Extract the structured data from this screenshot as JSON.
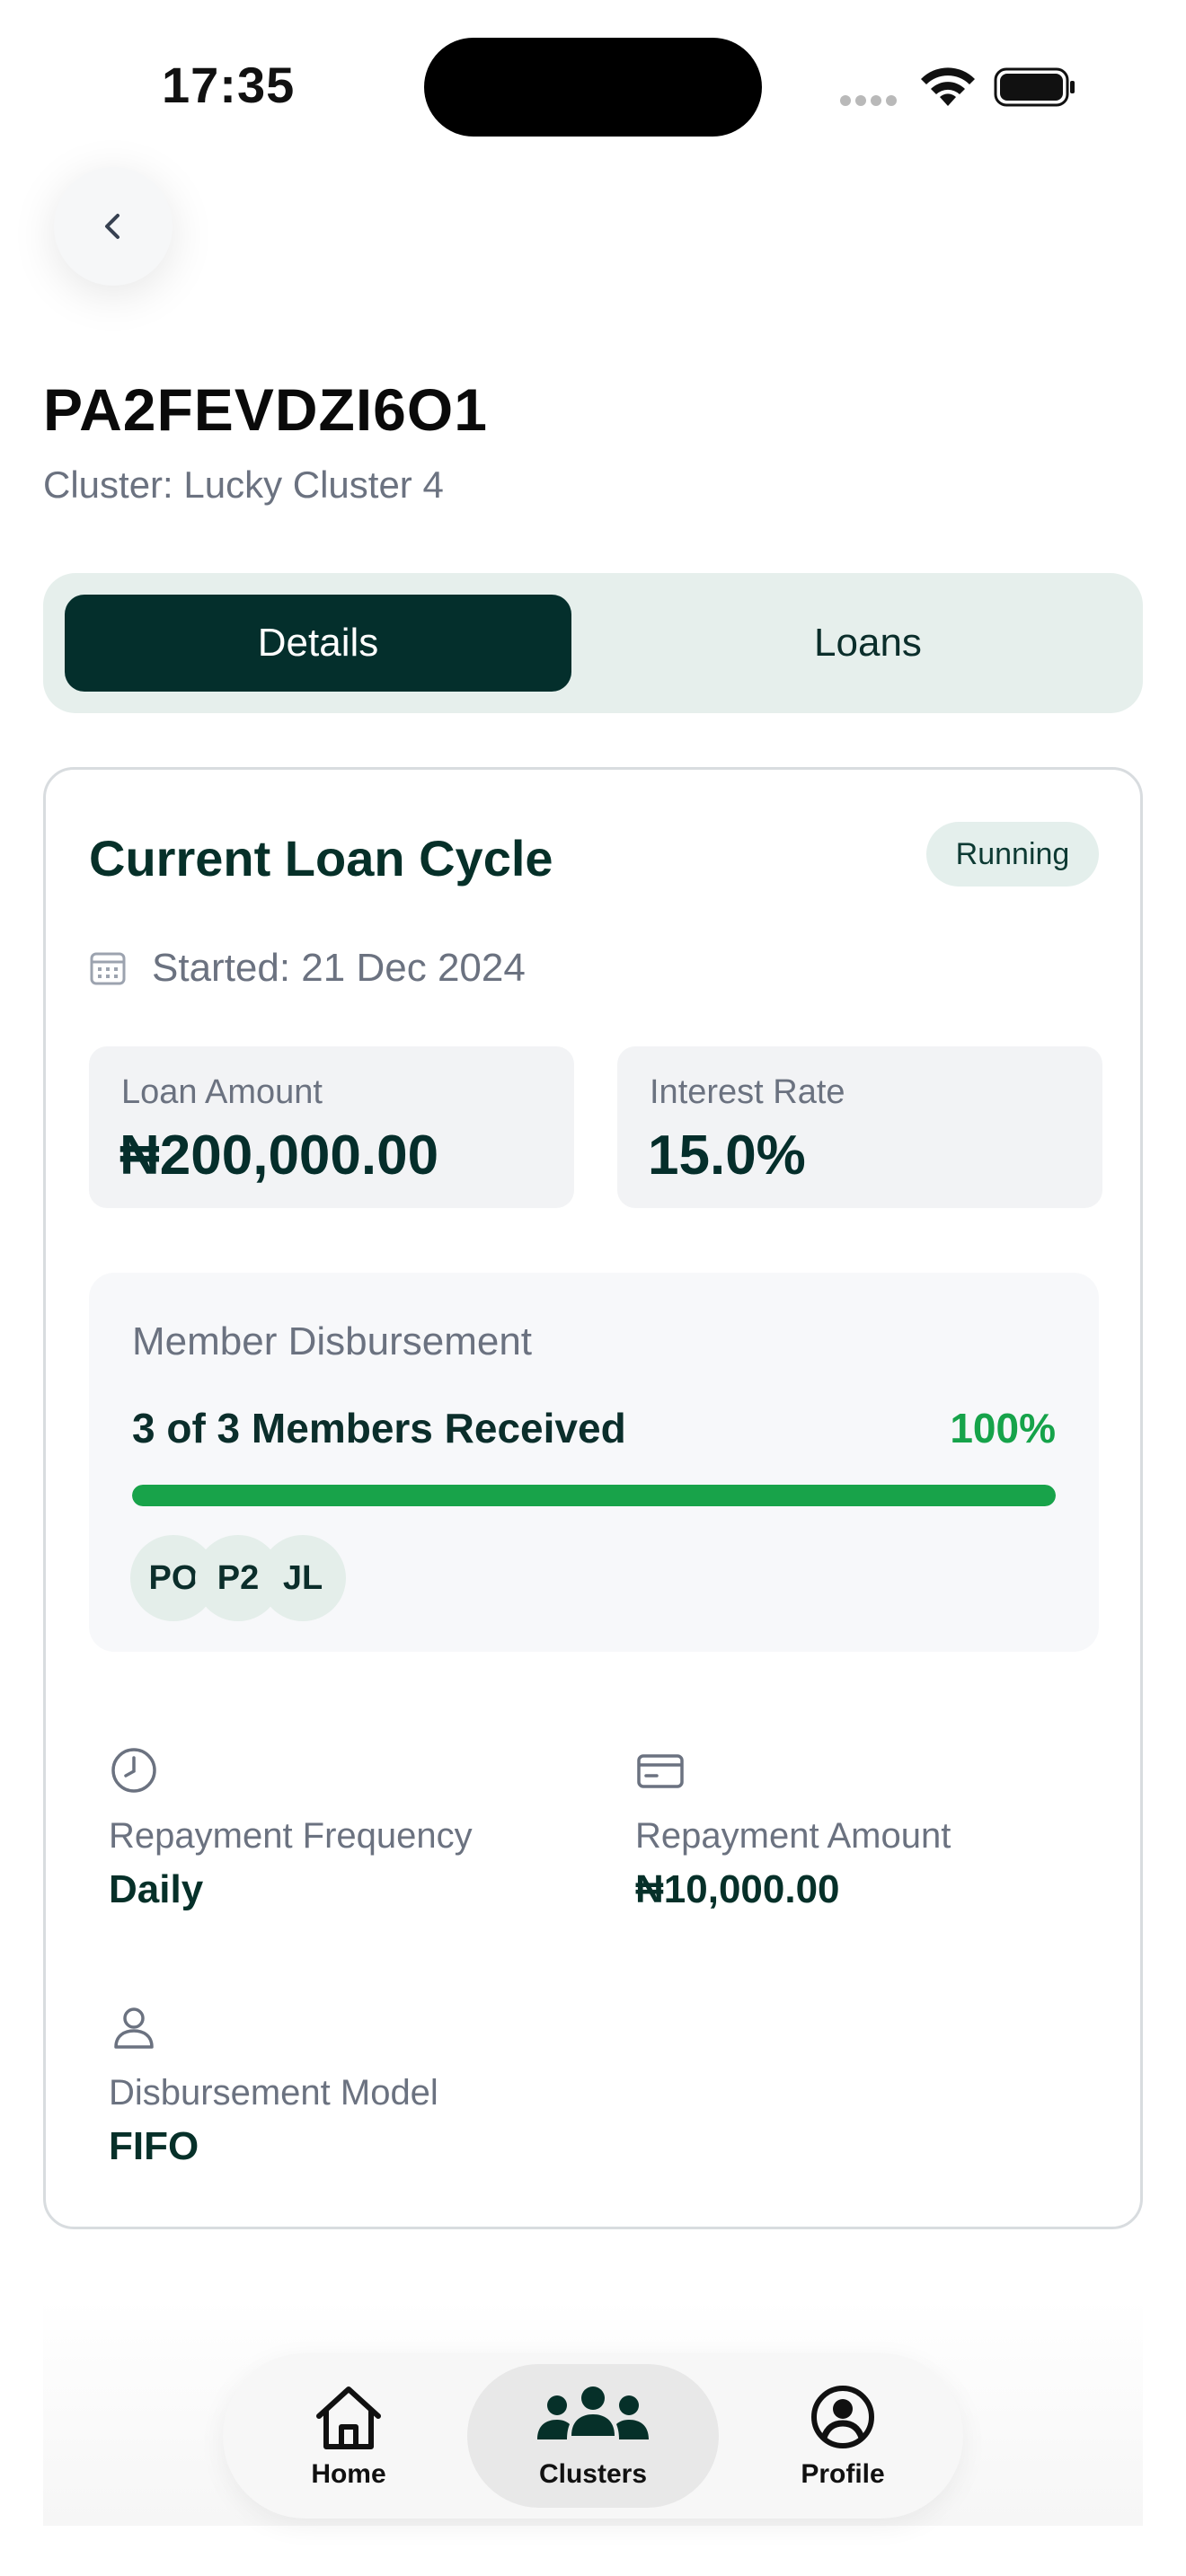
{
  "status_bar": {
    "time": "17:35"
  },
  "header": {
    "group_id": "PA2FEVDZI6O1",
    "cluster_line": "Cluster: Lucky Cluster 4"
  },
  "tabs": [
    {
      "label": "Details",
      "active": true
    },
    {
      "label": "Loans",
      "active": false
    }
  ],
  "loan_cycle": {
    "title": "Current Loan Cycle",
    "status": "Running",
    "started": "Started: 21 Dec 2024",
    "loan_amount": {
      "label": "Loan Amount",
      "value": "₦200,000.00"
    },
    "interest_rate": {
      "label": "Interest Rate",
      "value": "15.0%"
    },
    "disbursement": {
      "title": "Member Disbursement",
      "count_text": "3 of 3 Members Received",
      "percent_text": "100%",
      "progress": 1.0,
      "members": [
        "PO",
        "P2",
        "JL"
      ]
    },
    "repayment_frequency": {
      "label": "Repayment Frequency",
      "value": "Daily",
      "icon": "clock-icon"
    },
    "repayment_amount": {
      "label": "Repayment Amount",
      "value": "₦10,000.00",
      "icon": "card-icon"
    },
    "disbursement_model": {
      "label": "Disbursement Model",
      "value": "FIFO",
      "icon": "user-icon"
    }
  },
  "bottom_nav": [
    {
      "label": "Home",
      "icon": "home-icon",
      "active": false
    },
    {
      "label": "Clusters",
      "icon": "users-icon",
      "active": true
    },
    {
      "label": "Profile",
      "icon": "profile-icon",
      "active": false
    }
  ],
  "colors": {
    "primary": "#042f2c",
    "accent_green": "#16a34a",
    "tab_bg": "#e6efec",
    "muted_text": "#6b7280"
  }
}
